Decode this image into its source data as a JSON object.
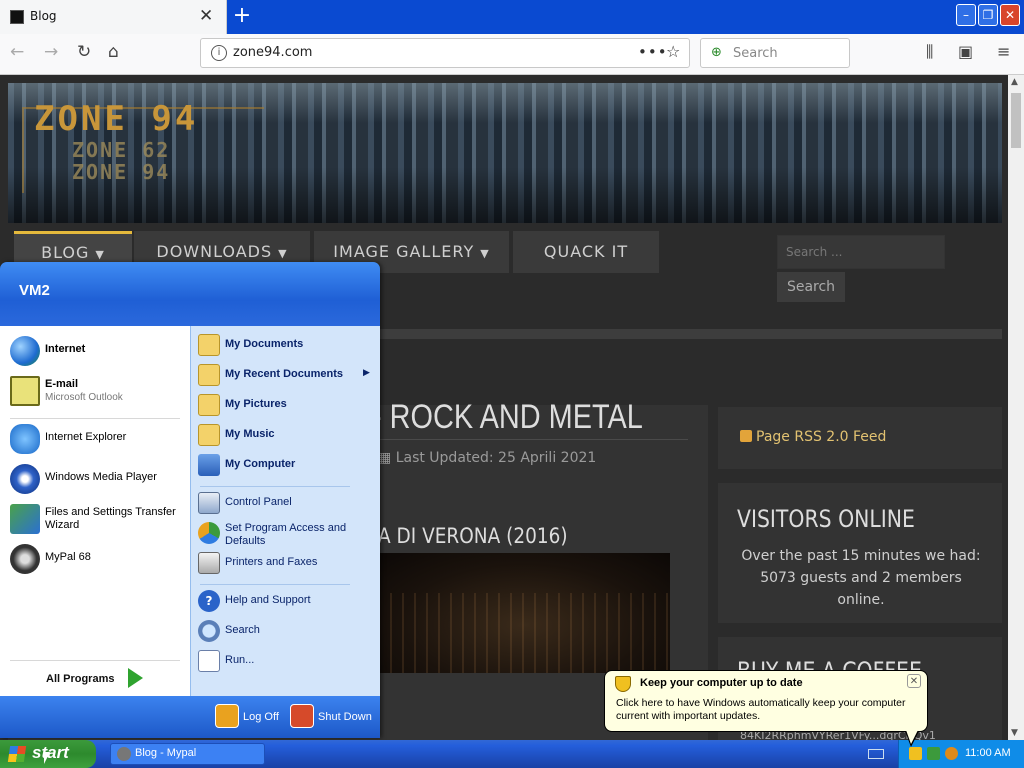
{
  "browser": {
    "tab_title": "Blog",
    "new_tab": "+",
    "address": "zone94.com",
    "search_placeholder": "Search"
  },
  "site": {
    "logo_main": "ZONE 94",
    "logo_sub1": "ZONE 62",
    "logo_sub2": "ZONE 94",
    "menu": [
      {
        "label": "BLOG",
        "has_caret": true
      },
      {
        "label": "DOWNLOADS",
        "has_caret": true
      },
      {
        "label": "IMAGE GALLERY",
        "has_caret": true
      },
      {
        "label": "QUACK IT",
        "has_caret": false
      }
    ],
    "search_placeholder": "Search ...",
    "search_button": "Search",
    "article_title": "- ROCK AND METAL",
    "last_updated": "Last Updated: 25 Aprili 2021",
    "article_subtitle": "A DI VERONA (2016)",
    "rss_label": "Page RSS 2.0 Feed",
    "visitors_heading": "VISITORS ONLINE",
    "visitors_text": "Over the past 15 minutes we had: 5073 guests and 2 members online.",
    "coffee_heading": "BUY ME A COFFEE",
    "coffee_address": "84KI2RRphmVYRer1VFy...dqrCNQv1"
  },
  "start_menu": {
    "user": "VM2",
    "pinned": [
      {
        "label": "Internet",
        "sub": ""
      },
      {
        "label": "E-mail",
        "sub": "Microsoft Outlook"
      }
    ],
    "recent": [
      "Internet Explorer",
      "Windows Media Player",
      "Files and Settings Transfer Wizard",
      "MyPal 68"
    ],
    "all_programs": "All Programs",
    "right": [
      "My Documents",
      "My Recent Documents",
      "My Pictures",
      "My Music",
      "My Computer",
      "Control Panel",
      "Set Program Access and Defaults",
      "Printers and Faxes",
      "Help and Support",
      "Search",
      "Run..."
    ],
    "log_off": "Log Off",
    "shut_down": "Shut Down"
  },
  "taskbar": {
    "start": "start",
    "task": "Blog - Mypal",
    "clock": "11:00 AM"
  },
  "balloon": {
    "title": "Keep your computer up to date",
    "message": "Click here to have Windows automatically keep your computer current with important updates."
  }
}
